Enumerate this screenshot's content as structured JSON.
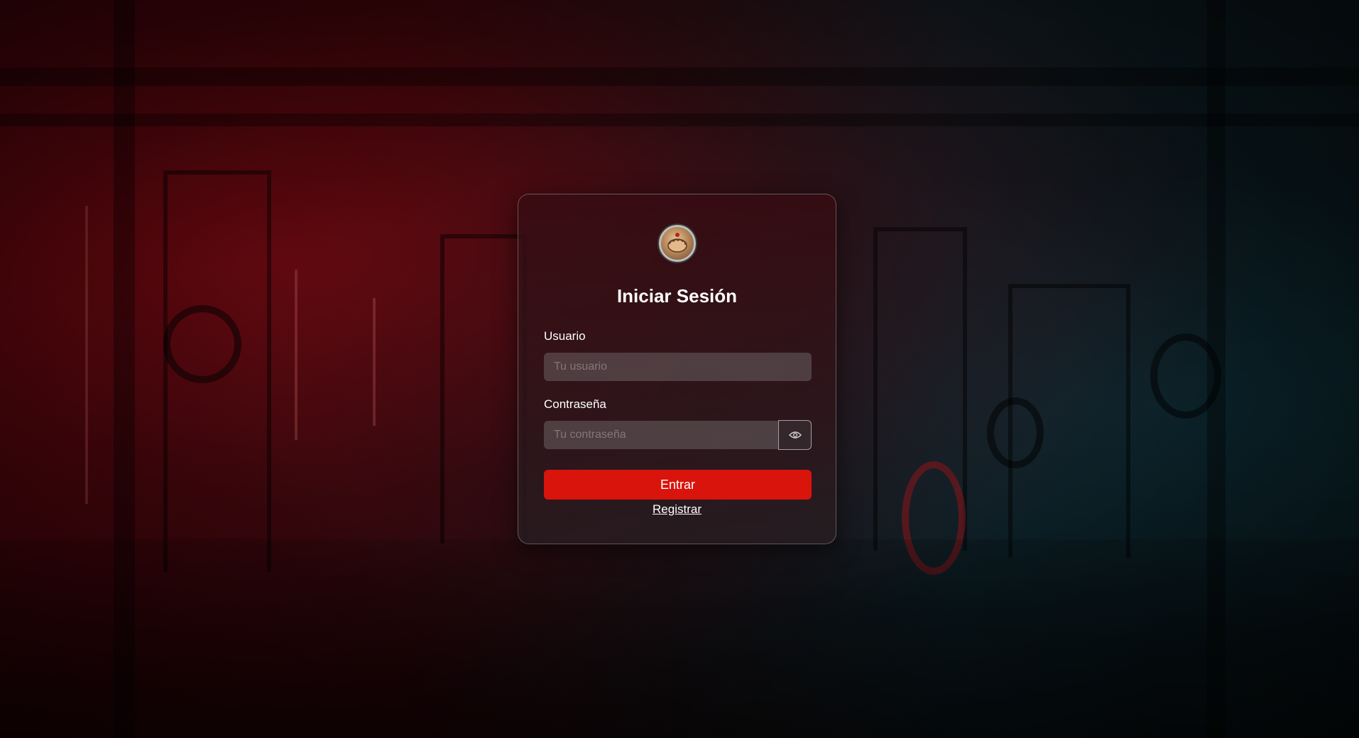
{
  "login": {
    "title": "Iniciar Sesión",
    "username_label": "Usuario",
    "username_placeholder": "Tu usuario",
    "username_value": "",
    "password_label": "Contraseña",
    "password_placeholder": "Tu contraseña",
    "password_value": "",
    "submit_label": "Entrar",
    "register_label": "Registrar",
    "logo_icon": "fist-logo-icon",
    "toggle_icon": "eye-icon"
  },
  "colors": {
    "accent": "#d8140c",
    "text": "#ffffff"
  }
}
